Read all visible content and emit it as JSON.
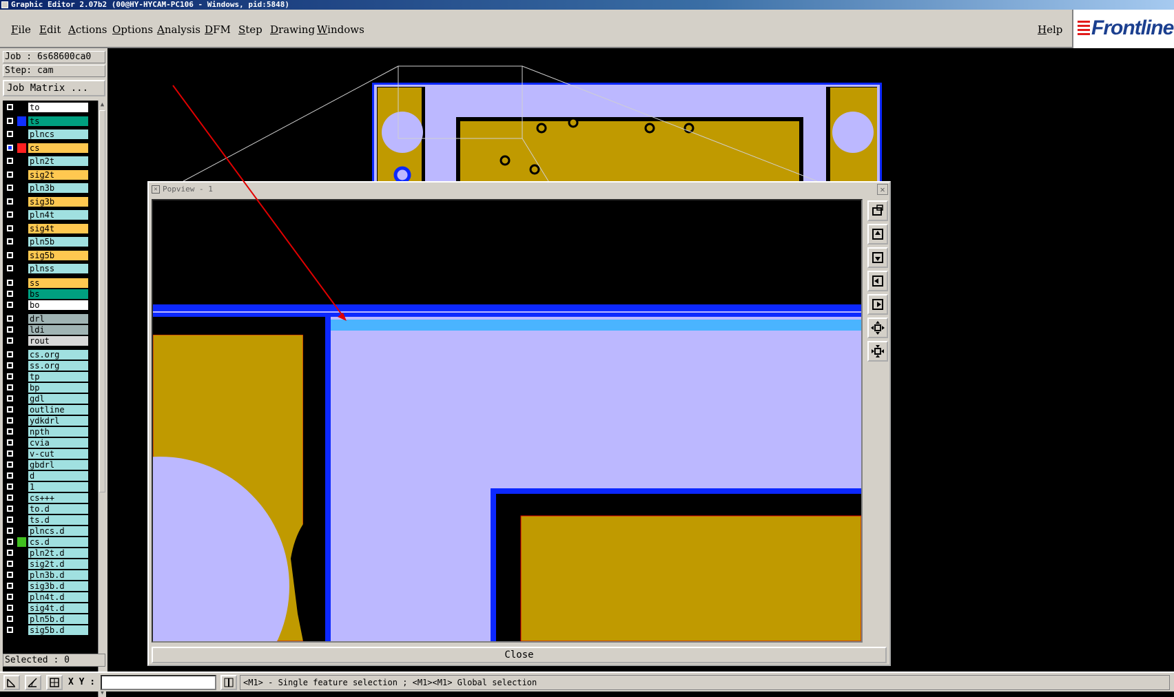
{
  "window": {
    "title": "Graphic Editor 2.07b2 (00@HY-HYCAM-PC106 - Windows, pid:5848)"
  },
  "menu": {
    "items": [
      "File",
      "Edit",
      "Actions",
      "Options",
      "Analysis",
      "DFM",
      "Step",
      "Drawing",
      "Windows"
    ],
    "help": "Help"
  },
  "logo": {
    "text": "Frontline"
  },
  "job": {
    "job_label": "Job : 6s68600ca0",
    "step_label": "Step: cam",
    "matrix_button": "Job Matrix ..."
  },
  "layers": [
    {
      "name": "to",
      "color": "#ffffff",
      "swatch": "#000000"
    },
    {
      "name": "ts",
      "color": "#00a080",
      "swatch": "#1030ff"
    },
    {
      "name": "plncs",
      "color": "#a0e0e0",
      "swatch": "#000000"
    },
    {
      "name": "cs",
      "color": "#ffc850",
      "swatch": "#ff2020",
      "active": true
    },
    {
      "name": "pln2t",
      "color": "#a0e0e0",
      "swatch": "#000000"
    },
    {
      "name": "sig2t",
      "color": "#ffc850",
      "swatch": "#000000"
    },
    {
      "name": "pln3b",
      "color": "#a0e0e0",
      "swatch": "#000000"
    },
    {
      "name": "sig3b",
      "color": "#ffc850",
      "swatch": "#000000"
    },
    {
      "name": "pln4t",
      "color": "#a0e0e0",
      "swatch": "#000000"
    },
    {
      "name": "sig4t",
      "color": "#ffc850",
      "swatch": "#000000"
    },
    {
      "name": "pln5b",
      "color": "#a0e0e0",
      "swatch": "#000000"
    },
    {
      "name": "sig5b",
      "color": "#ffc850",
      "swatch": "#000000"
    },
    {
      "name": "plnss",
      "color": "#a0e0e0",
      "swatch": "#000000"
    },
    {
      "name": "ss",
      "color": "#ffc850",
      "swatch": "#000000"
    },
    {
      "name": "bs",
      "color": "#00a080",
      "swatch": "#000000"
    },
    {
      "name": "bo",
      "color": "#ffffff",
      "swatch": "#000000"
    },
    {
      "name": "drl",
      "color": "#a0b4b4",
      "swatch": "#000000"
    },
    {
      "name": "ldi",
      "color": "#a0b4b4",
      "swatch": "#000000"
    },
    {
      "name": "rout",
      "color": "#d8d8d8",
      "swatch": "#000000"
    },
    {
      "name": "cs.org",
      "color": "#a0e0e0",
      "swatch": "#000000"
    },
    {
      "name": "ss.org",
      "color": "#a0e0e0",
      "swatch": "#000000"
    },
    {
      "name": "tp",
      "color": "#a0e0e0",
      "swatch": "#000000"
    },
    {
      "name": "bp",
      "color": "#a0e0e0",
      "swatch": "#000000"
    },
    {
      "name": "gdl",
      "color": "#a0e0e0",
      "swatch": "#000000"
    },
    {
      "name": "outline",
      "color": "#a0e0e0",
      "swatch": "#000000"
    },
    {
      "name": "ydkdrl",
      "color": "#a0e0e0",
      "swatch": "#000000"
    },
    {
      "name": "npth",
      "color": "#a0e0e0",
      "swatch": "#000000"
    },
    {
      "name": "cvia",
      "color": "#a0e0e0",
      "swatch": "#000000"
    },
    {
      "name": "v-cut",
      "color": "#a0e0e0",
      "swatch": "#000000"
    },
    {
      "name": "gbdrl",
      "color": "#a0e0e0",
      "swatch": "#000000"
    },
    {
      "name": "d",
      "color": "#a0e0e0",
      "swatch": "#000000"
    },
    {
      "name": "1",
      "color": "#a0e0e0",
      "swatch": "#000000"
    },
    {
      "name": "cs+++",
      "color": "#a0e0e0",
      "swatch": "#000000"
    },
    {
      "name": "to.d",
      "color": "#a0e0e0",
      "swatch": "#000000"
    },
    {
      "name": "ts.d",
      "color": "#a0e0e0",
      "swatch": "#000000"
    },
    {
      "name": "plncs.d",
      "color": "#a0e0e0",
      "swatch": "#000000"
    },
    {
      "name": "cs.d",
      "color": "#a0e0e0",
      "swatch": "#40c020"
    },
    {
      "name": "pln2t.d",
      "color": "#a0e0e0",
      "swatch": "#000000"
    },
    {
      "name": "sig2t.d",
      "color": "#a0e0e0",
      "swatch": "#000000"
    },
    {
      "name": "pln3b.d",
      "color": "#a0e0e0",
      "swatch": "#000000"
    },
    {
      "name": "sig3b.d",
      "color": "#a0e0e0",
      "swatch": "#000000"
    },
    {
      "name": "pln4t.d",
      "color": "#a0e0e0",
      "swatch": "#000000"
    },
    {
      "name": "sig4t.d",
      "color": "#a0e0e0",
      "swatch": "#000000"
    },
    {
      "name": "pln5b.d",
      "color": "#a0e0e0",
      "swatch": "#000000"
    },
    {
      "name": "sig5b.d",
      "color": "#a0e0e0",
      "swatch": "#000000"
    }
  ],
  "selected": "Selected : 0",
  "status": {
    "xy_label": "X Y :",
    "xy_value": "",
    "message": "<M1> - Single feature selection ; <M1><M1> Global selection"
  },
  "popview": {
    "title": "Popview - 1",
    "close_label": "Close"
  },
  "colors": {
    "copper": "#c09a00",
    "laminate": "#bcb8ff",
    "outline_blue": "#0c28ff",
    "highlight_blue": "#4ab4ff",
    "arrow_red": "#e00000"
  }
}
